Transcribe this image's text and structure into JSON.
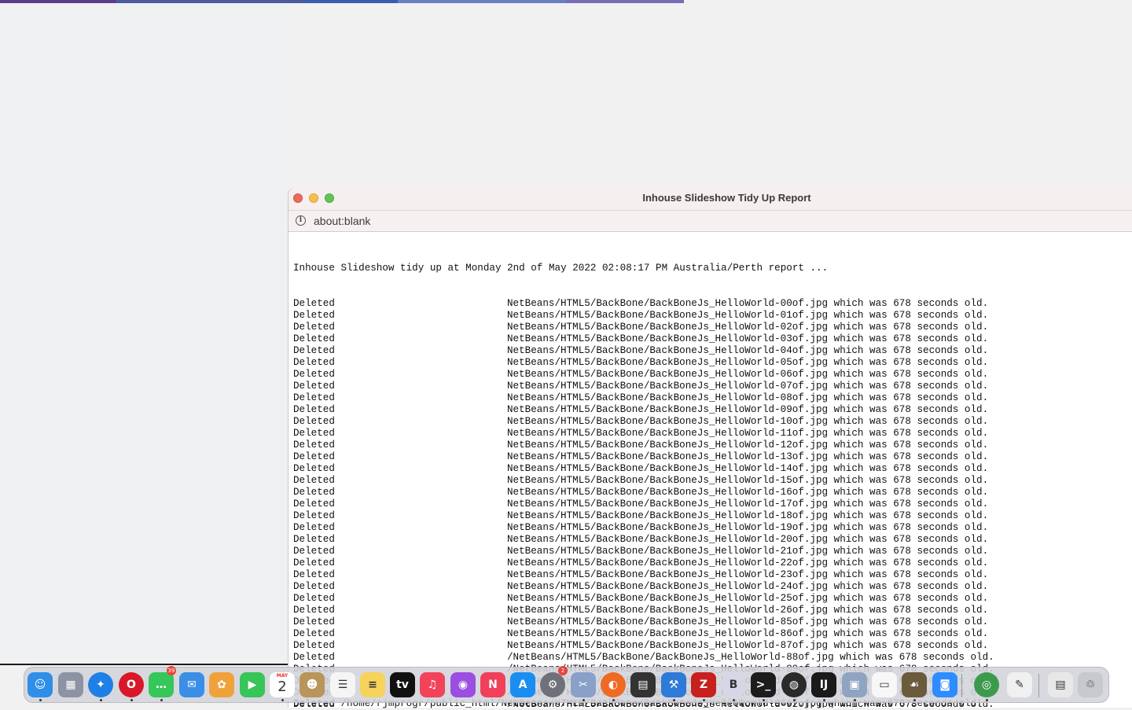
{
  "window": {
    "title": "Inhouse Slideshow Tidy Up Report",
    "url": "about:blank"
  },
  "report": {
    "header": "Inhouse Slideshow tidy up at Monday 2nd of May 2022 02:08:17 PM Australia/Perth report ...",
    "lines": [
      {
        "action": "Deleted",
        "detail": "NetBeans/HTML5/BackBone/BackBoneJs_HelloWorld-00of.jpg which was 678 seconds old."
      },
      {
        "action": "Deleted",
        "detail": "NetBeans/HTML5/BackBone/BackBoneJs_HelloWorld-01of.jpg which was 678 seconds old."
      },
      {
        "action": "Deleted",
        "detail": "NetBeans/HTML5/BackBone/BackBoneJs_HelloWorld-02of.jpg which was 678 seconds old."
      },
      {
        "action": "Deleted",
        "detail": "NetBeans/HTML5/BackBone/BackBoneJs_HelloWorld-03of.jpg which was 678 seconds old."
      },
      {
        "action": "Deleted",
        "detail": "NetBeans/HTML5/BackBone/BackBoneJs_HelloWorld-04of.jpg which was 678 seconds old."
      },
      {
        "action": "Deleted",
        "detail": "NetBeans/HTML5/BackBone/BackBoneJs_HelloWorld-05of.jpg which was 678 seconds old."
      },
      {
        "action": "Deleted",
        "detail": "NetBeans/HTML5/BackBone/BackBoneJs_HelloWorld-06of.jpg which was 678 seconds old."
      },
      {
        "action": "Deleted",
        "detail": "NetBeans/HTML5/BackBone/BackBoneJs_HelloWorld-07of.jpg which was 678 seconds old."
      },
      {
        "action": "Deleted",
        "detail": "NetBeans/HTML5/BackBone/BackBoneJs_HelloWorld-08of.jpg which was 678 seconds old."
      },
      {
        "action": "Deleted",
        "detail": "NetBeans/HTML5/BackBone/BackBoneJs_HelloWorld-09of.jpg which was 678 seconds old."
      },
      {
        "action": "Deleted",
        "detail": "NetBeans/HTML5/BackBone/BackBoneJs_HelloWorld-10of.jpg which was 678 seconds old."
      },
      {
        "action": "Deleted",
        "detail": "NetBeans/HTML5/BackBone/BackBoneJs_HelloWorld-11of.jpg which was 678 seconds old."
      },
      {
        "action": "Deleted",
        "detail": "NetBeans/HTML5/BackBone/BackBoneJs_HelloWorld-12of.jpg which was 678 seconds old."
      },
      {
        "action": "Deleted",
        "detail": "NetBeans/HTML5/BackBone/BackBoneJs_HelloWorld-13of.jpg which was 678 seconds old."
      },
      {
        "action": "Deleted",
        "detail": "NetBeans/HTML5/BackBone/BackBoneJs_HelloWorld-14of.jpg which was 678 seconds old."
      },
      {
        "action": "Deleted",
        "detail": "NetBeans/HTML5/BackBone/BackBoneJs_HelloWorld-15of.jpg which was 678 seconds old."
      },
      {
        "action": "Deleted",
        "detail": "NetBeans/HTML5/BackBone/BackBoneJs_HelloWorld-16of.jpg which was 678 seconds old."
      },
      {
        "action": "Deleted",
        "detail": "NetBeans/HTML5/BackBone/BackBoneJs_HelloWorld-17of.jpg which was 678 seconds old."
      },
      {
        "action": "Deleted",
        "detail": "NetBeans/HTML5/BackBone/BackBoneJs_HelloWorld-18of.jpg which was 678 seconds old."
      },
      {
        "action": "Deleted",
        "detail": "NetBeans/HTML5/BackBone/BackBoneJs_HelloWorld-19of.jpg which was 678 seconds old."
      },
      {
        "action": "Deleted",
        "detail": "NetBeans/HTML5/BackBone/BackBoneJs_HelloWorld-20of.jpg which was 678 seconds old."
      },
      {
        "action": "Deleted",
        "detail": "NetBeans/HTML5/BackBone/BackBoneJs_HelloWorld-21of.jpg which was 678 seconds old."
      },
      {
        "action": "Deleted",
        "detail": "NetBeans/HTML5/BackBone/BackBoneJs_HelloWorld-22of.jpg which was 678 seconds old."
      },
      {
        "action": "Deleted",
        "detail": "NetBeans/HTML5/BackBone/BackBoneJs_HelloWorld-23of.jpg which was 678 seconds old."
      },
      {
        "action": "Deleted",
        "detail": "NetBeans/HTML5/BackBone/BackBoneJs_HelloWorld-24of.jpg which was 678 seconds old."
      },
      {
        "action": "Deleted",
        "detail": "NetBeans/HTML5/BackBone/BackBoneJs_HelloWorld-25of.jpg which was 678 seconds old."
      },
      {
        "action": "Deleted",
        "detail": "NetBeans/HTML5/BackBone/BackBoneJs_HelloWorld-26of.jpg which was 678 seconds old."
      },
      {
        "action": "Deleted",
        "detail": "NetBeans/HTML5/BackBone/BackBoneJs_HelloWorld-85of.jpg which was 678 seconds old."
      },
      {
        "action": "Deleted",
        "detail": "NetBeans/HTML5/BackBone/BackBoneJs_HelloWorld-86of.jpg which was 678 seconds old."
      },
      {
        "action": "Deleted",
        "detail": "NetBeans/HTML5/BackBone/BackBoneJs_HelloWorld-87of.jpg which was 678 seconds old."
      },
      {
        "action": "Deleted",
        "detail": "/NetBeans/HTML5/BackBone/BackBoneJs_HelloWorld-88of.jpg which was 678 seconds old."
      },
      {
        "action": "Deleted",
        "detail": "/NetBeans/HTML5/BackBone/BackBoneJs_HelloWorld-89of.jpg which was 678 seconds old."
      },
      {
        "action": "Deleted",
        "detail": "/NetBeans/HTML5/BackBone/BackBoneJs_HelloWorld-90of.jpg which was 678 seconds old."
      },
      {
        "action": "Deleted",
        "detail": "/NetBeans/HTML5/BackBone/BackBoneJs_HelloWorld-91of.jpg which was 678 seconds old."
      },
      {
        "action": "Deleted",
        "detail": "/NetBeans/HTML5/BackBone/BackBoneJs_HelloWorld-92of.jpg which was 678 seconds old."
      }
    ],
    "partial_line": "Deleted /home/rjmprogr/public_html/NetBeans/HTML5/BackBone/BackBoneJs_HelloWorld-96of.jpg which was 678 seconds old."
  },
  "dock": {
    "items": [
      {
        "name": "finder-icon",
        "glyph": "☺",
        "color": "#2f8ee8",
        "dot": true
      },
      {
        "name": "launchpad-icon",
        "glyph": "▦",
        "color": "#8c93a3",
        "dot": false
      },
      {
        "name": "safari-icon",
        "glyph": "✦",
        "color": "#1e80e6",
        "dot": true,
        "round": true
      },
      {
        "name": "opera-icon",
        "glyph": "O",
        "color": "#d8182a",
        "dot": true,
        "round": true
      },
      {
        "name": "messages-icon",
        "glyph": "…",
        "color": "#35c759",
        "dot": true,
        "badge": "39"
      },
      {
        "name": "mail-icon",
        "glyph": "✉",
        "color": "#3a8ee6",
        "dot": false
      },
      {
        "name": "photos-icon",
        "glyph": "✿",
        "color": "#f0a23a",
        "dot": false
      },
      {
        "name": "facetime-icon",
        "glyph": "▶",
        "color": "#37c458",
        "dot": false
      },
      {
        "name": "calendar-icon",
        "glyph": "",
        "color": "#ffffff",
        "dot": true,
        "calendar": true,
        "month": "MAY",
        "day": "2"
      },
      {
        "name": "contacts-icon",
        "glyph": "☻",
        "color": "#b8955a",
        "dot": false
      },
      {
        "name": "reminders-icon",
        "glyph": "☰",
        "color": "#f5f5f5",
        "dot": false,
        "dark": true
      },
      {
        "name": "notes-icon",
        "glyph": "≡",
        "color": "#f6d35a",
        "dot": false,
        "dark": true
      },
      {
        "name": "apple-tv-icon",
        "glyph": "tv",
        "color": "#111111",
        "dot": false
      },
      {
        "name": "music-icon",
        "glyph": "♫",
        "color": "#f2435a",
        "dot": false
      },
      {
        "name": "podcasts-icon",
        "glyph": "◉",
        "color": "#9b4ee0",
        "dot": false
      },
      {
        "name": "news-icon",
        "glyph": "N",
        "color": "#f0405a",
        "dot": false
      },
      {
        "name": "app-store-icon",
        "glyph": "A",
        "color": "#1a8ef0",
        "dot": false
      },
      {
        "name": "system-preferences-icon",
        "glyph": "⚙",
        "color": "#6f7078",
        "dot": false,
        "round": true,
        "badge": "2"
      },
      {
        "name": "preview-icon",
        "glyph": "✂",
        "color": "#8aa0c8",
        "dot": true
      },
      {
        "name": "firefox-icon",
        "glyph": "◐",
        "color": "#f06a24",
        "dot": true,
        "round": true
      },
      {
        "name": "calculator-icon",
        "glyph": "▤",
        "color": "#333333",
        "dot": false
      },
      {
        "name": "xcode-icon",
        "glyph": "⚒",
        "color": "#2d7ad8",
        "dot": true
      },
      {
        "name": "filezilla-icon",
        "glyph": "Z",
        "color": "#c8201e",
        "dot": true
      },
      {
        "name": "bbedit-icon",
        "glyph": "B",
        "color": "#d6d6e6",
        "dot": true,
        "dark": true,
        "round": true
      },
      {
        "name": "terminal-icon",
        "glyph": ">_",
        "color": "#1c1c1c",
        "dot": true
      },
      {
        "name": "sequel-pro-icon",
        "glyph": "◍",
        "color": "#2a2a2a",
        "dot": true,
        "round": true
      },
      {
        "name": "intellij-icon",
        "glyph": "IJ",
        "color": "#1a1a1a",
        "dot": true
      },
      {
        "name": "screenshot-icon",
        "glyph": "▣",
        "color": "#8fa4c0",
        "dot": true
      },
      {
        "name": "textedit-icon",
        "glyph": "▭",
        "color": "#f7f7f7",
        "dot": false,
        "dark": true
      },
      {
        "name": "gimp-icon",
        "glyph": "☙",
        "color": "#6b5a3c",
        "dot": true
      },
      {
        "name": "zoom-icon",
        "glyph": "◙",
        "color": "#2d8cff",
        "dot": false
      },
      {
        "name": "chrome-icon",
        "glyph": "◎",
        "color": "#3c9a4e",
        "dot": true,
        "round": true
      },
      {
        "name": "script-editor-icon",
        "glyph": "✎",
        "color": "#f0f0f0",
        "dot": false,
        "dark": true
      },
      {
        "name": "documents-stack-icon",
        "glyph": "▤",
        "color": "#e8e8e8",
        "dot": false,
        "dark": true
      },
      {
        "name": "trash-icon",
        "glyph": "♲",
        "color": "#c7c9cf",
        "dot": false,
        "dark": true
      }
    ]
  }
}
